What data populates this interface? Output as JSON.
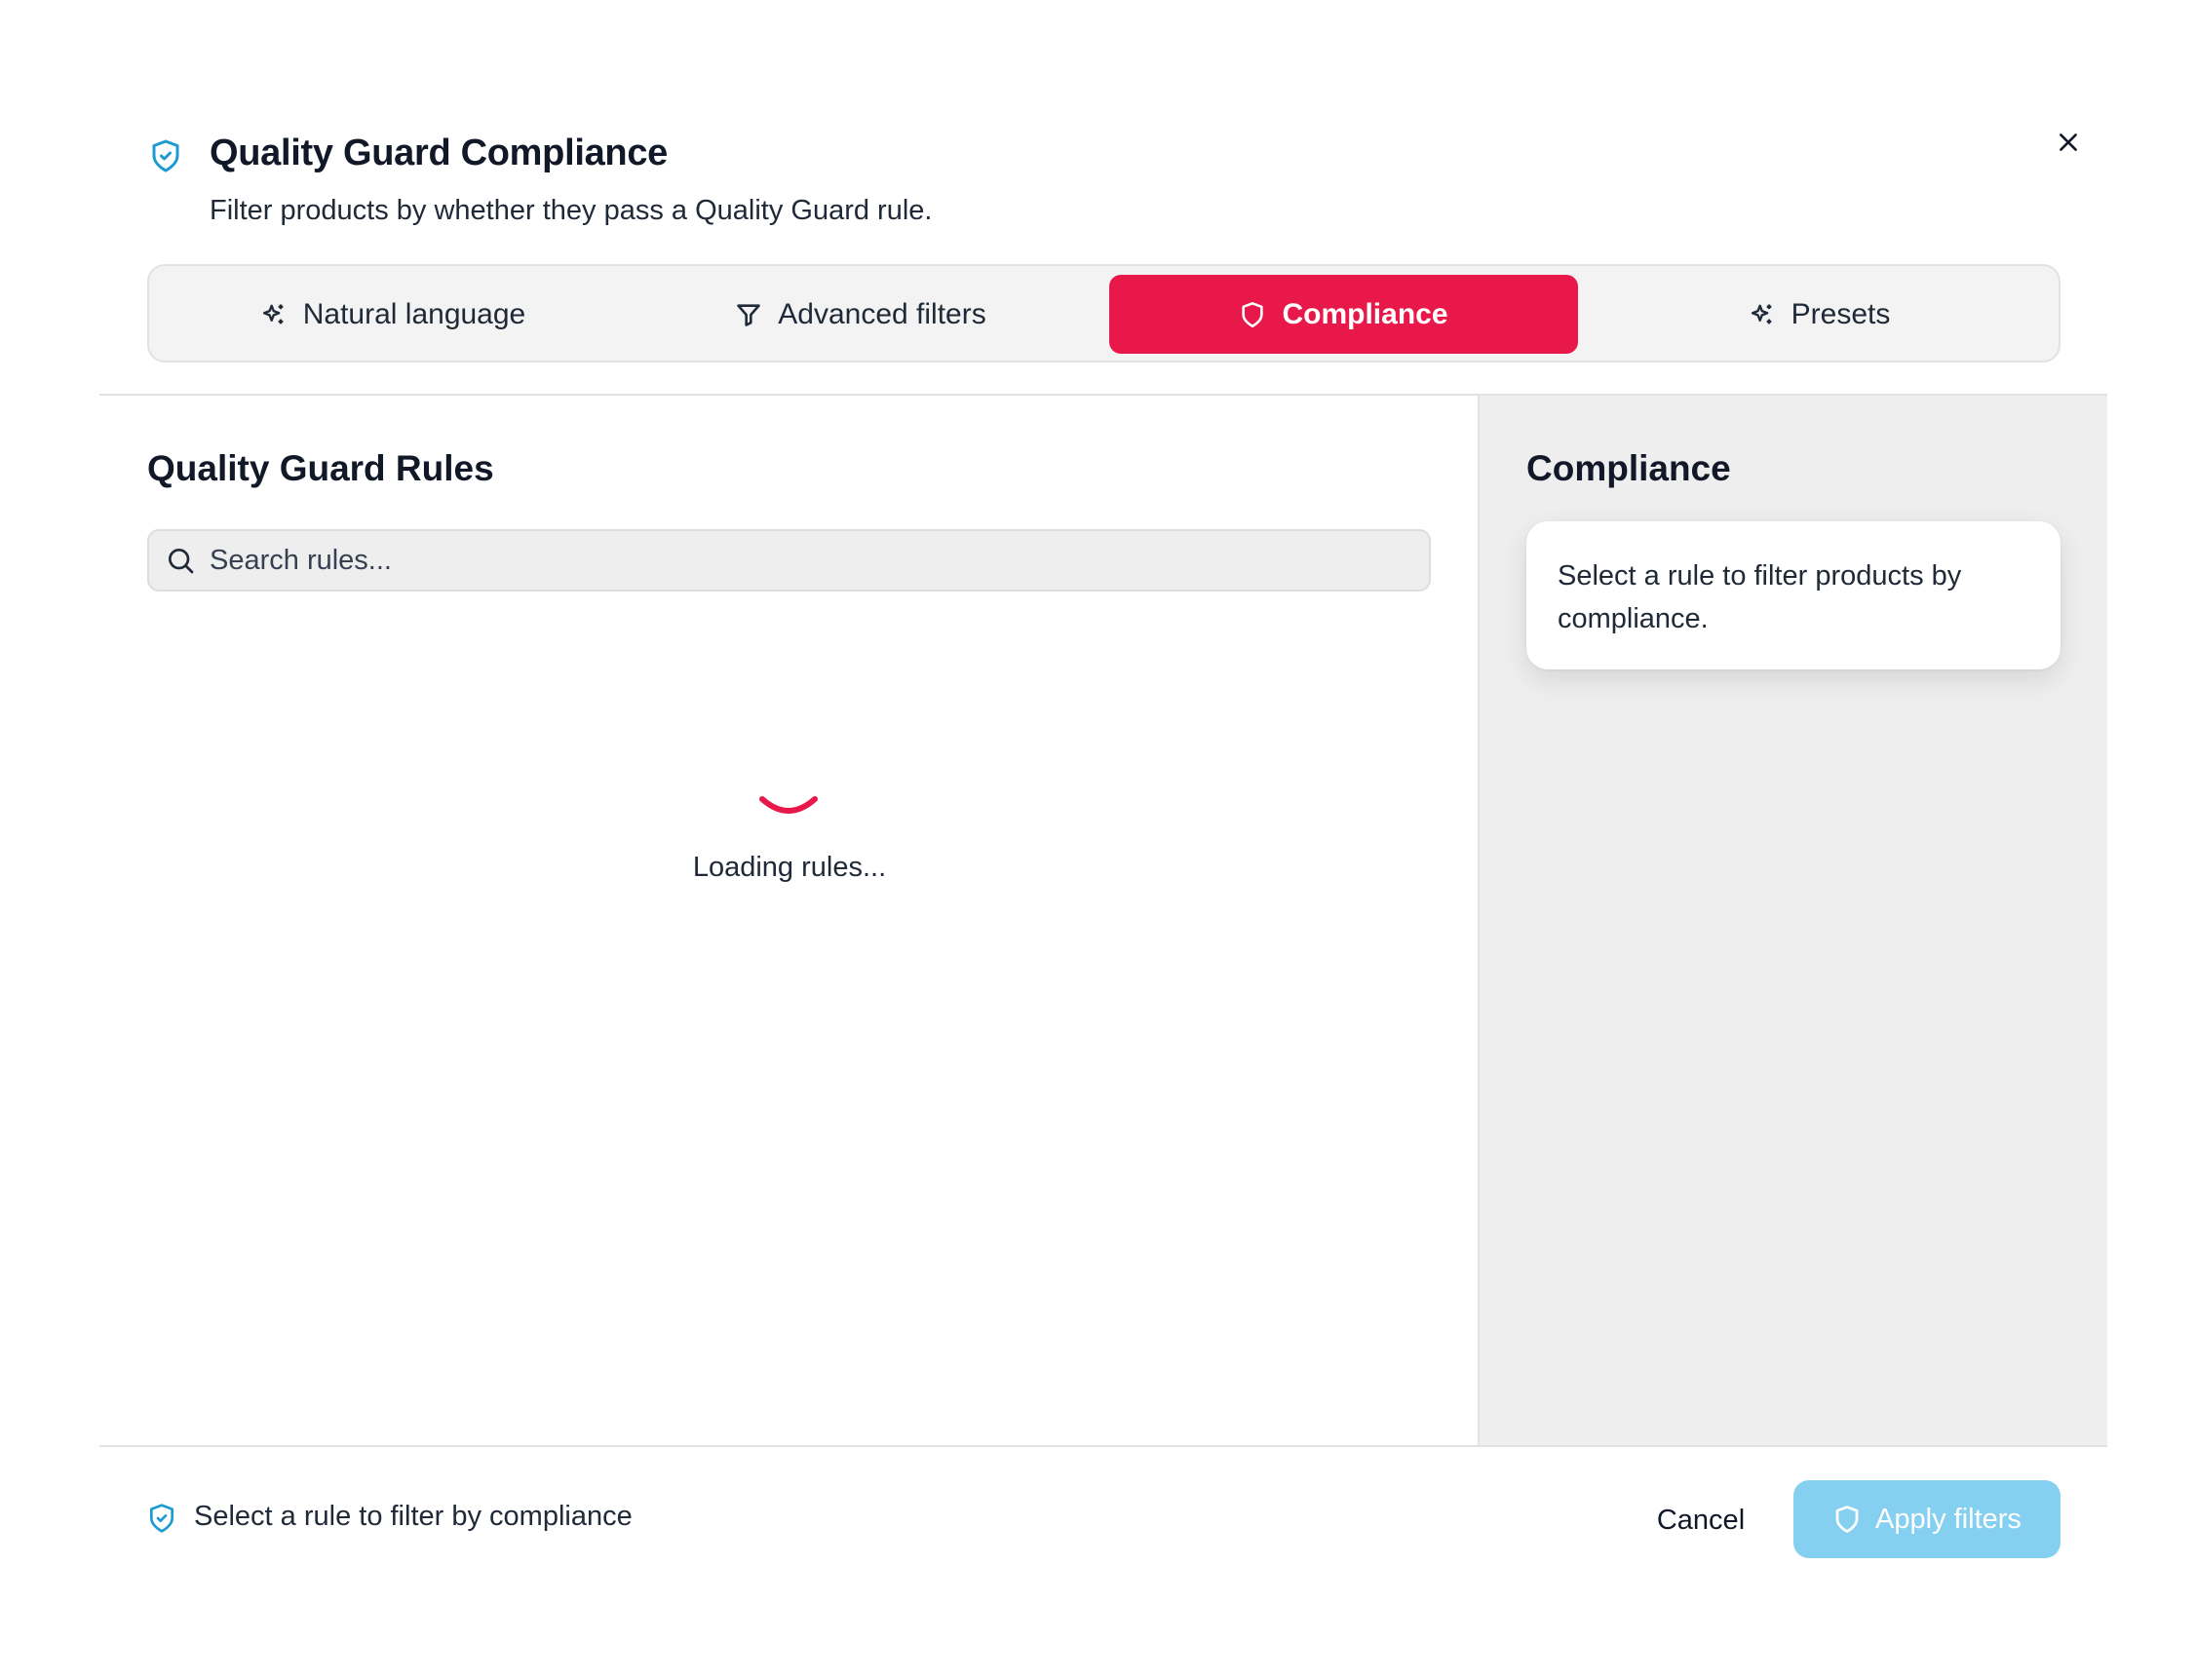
{
  "dialog": {
    "title": "Quality Guard Compliance",
    "subtitle": "Filter products by whether they pass a Quality Guard rule.",
    "close_icon": "close-icon",
    "header_icon": "shield-check-icon"
  },
  "tabs": [
    {
      "label": "Natural language",
      "icon": "sparkles-icon",
      "active": false
    },
    {
      "label": "Advanced filters",
      "icon": "filter-icon",
      "active": false
    },
    {
      "label": "Compliance",
      "icon": "shield-icon",
      "active": true
    },
    {
      "label": "Presets",
      "icon": "sparkles-icon",
      "active": false
    }
  ],
  "rules_panel": {
    "heading": "Quality Guard Rules",
    "search_placeholder": "Search rules...",
    "search_value": "",
    "loading_text": "Loading rules..."
  },
  "compliance_panel": {
    "heading": "Compliance",
    "info_text": "Select a rule to filter products by compliance."
  },
  "footer": {
    "status_text": "Select a rule to filter by compliance",
    "cancel_label": "Cancel",
    "apply_label": "Apply filters"
  },
  "colors": {
    "accent": "#e8194a",
    "brand_blue": "#1d9bd1",
    "apply_disabled": "#85d0f1"
  }
}
